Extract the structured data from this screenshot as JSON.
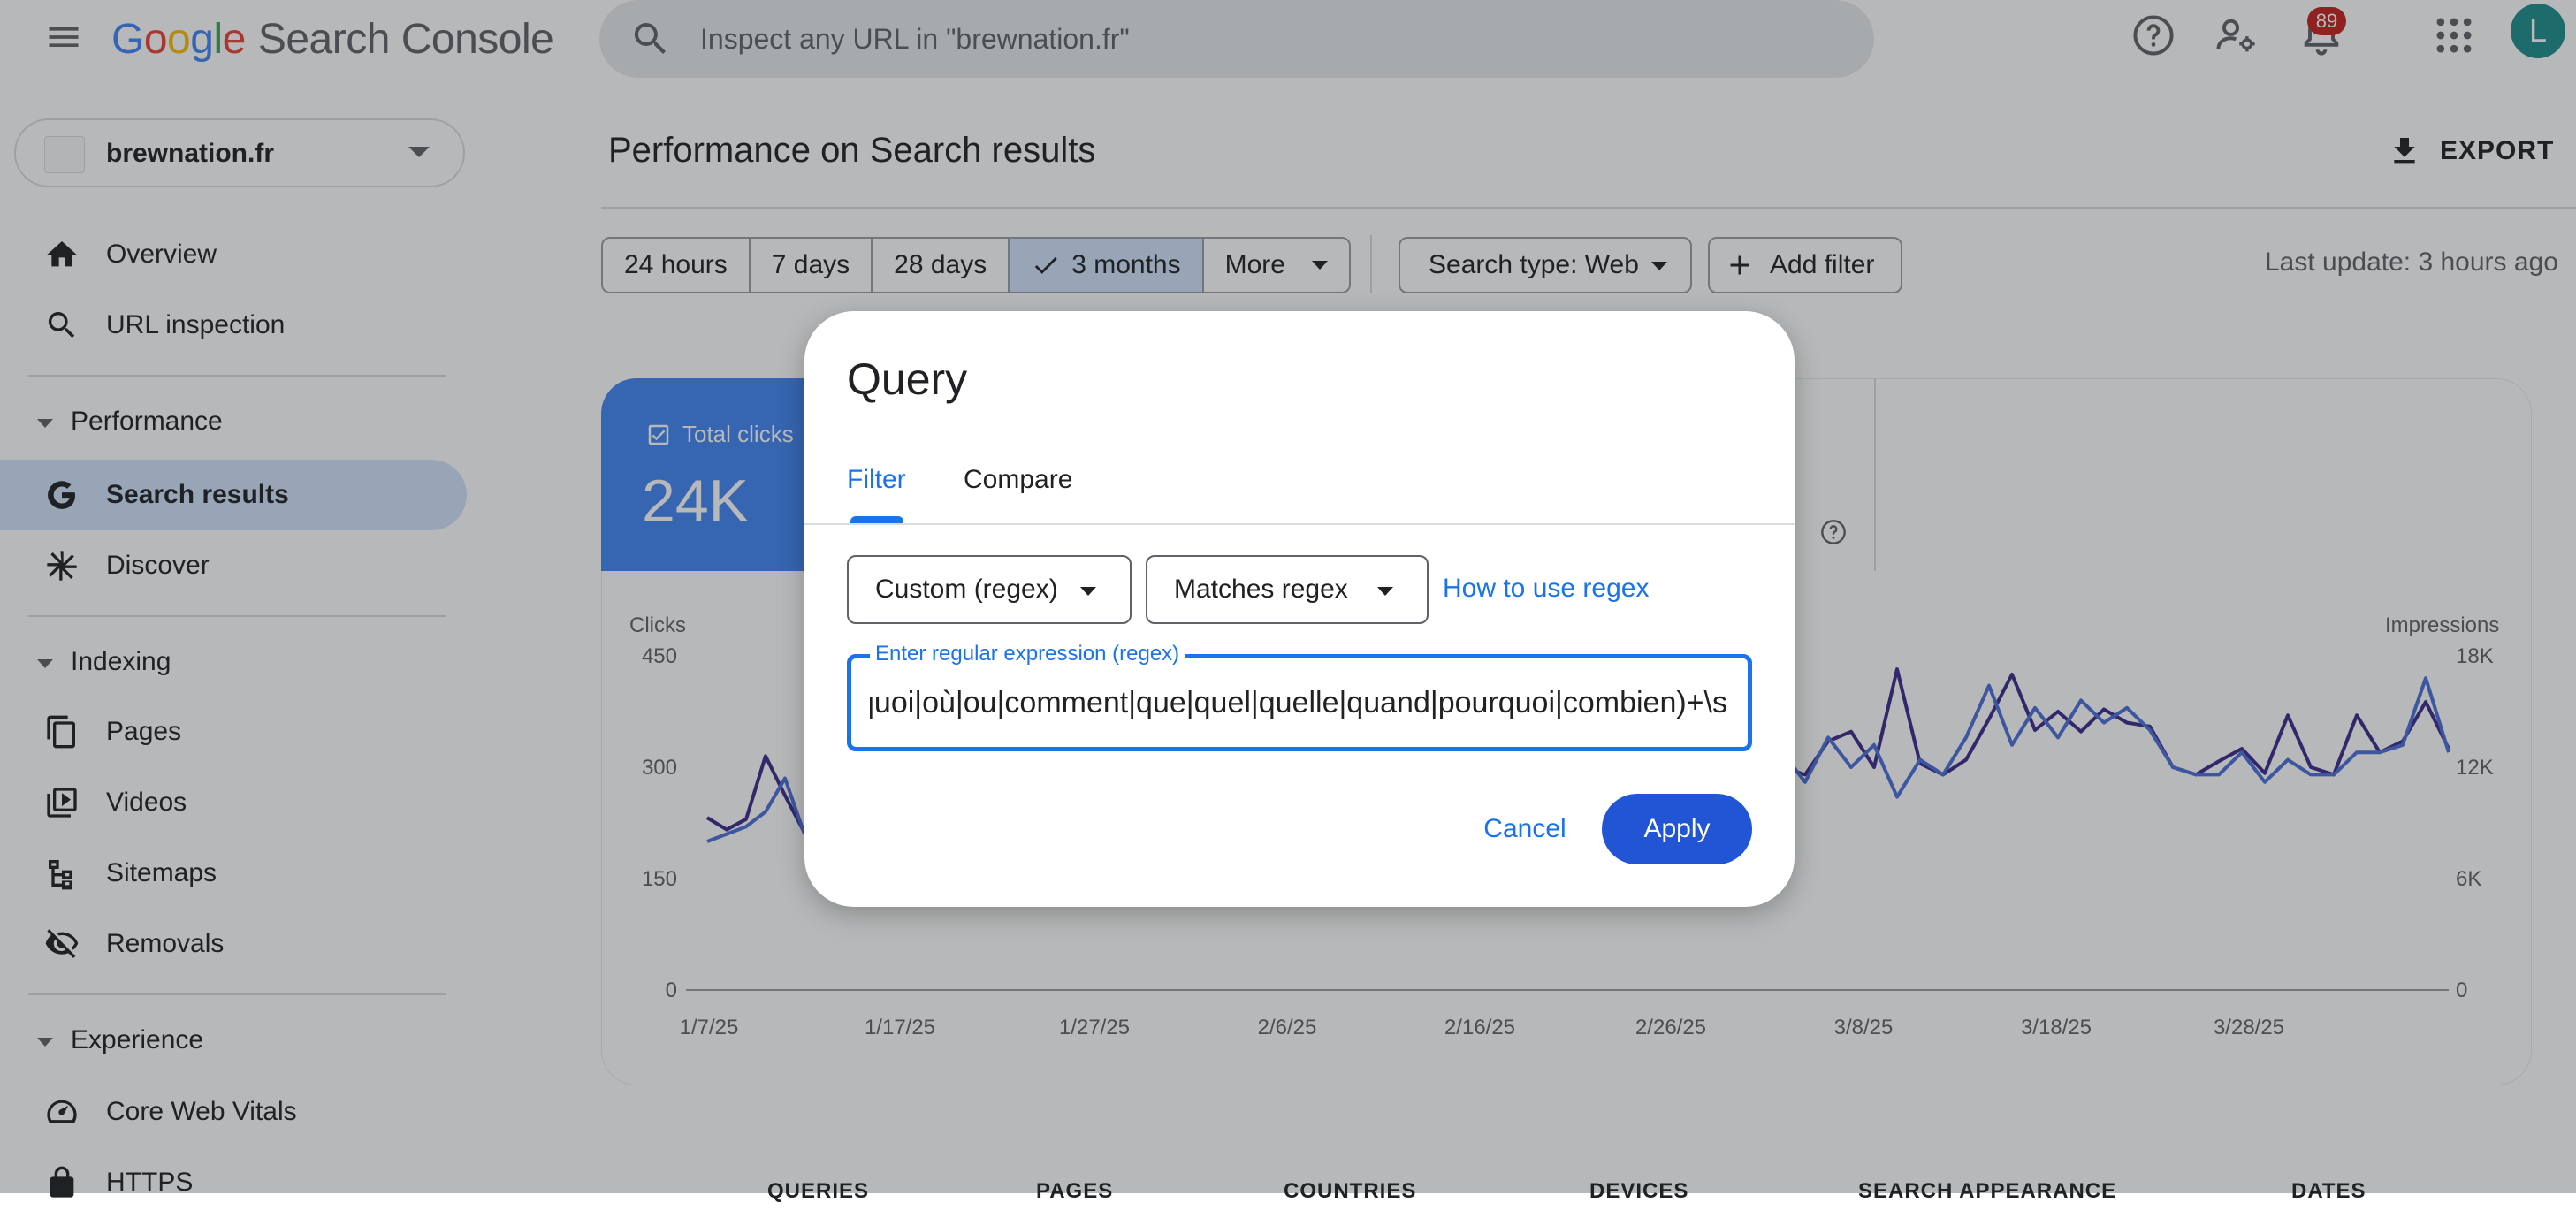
{
  "app": {
    "logo_letters": [
      "G",
      "o",
      "o",
      "g",
      "l",
      "e"
    ],
    "product": "Search Console",
    "search_placeholder": "Inspect any URL in \"brewnation.fr\"",
    "notifications_count": "89",
    "avatar_initial": "L"
  },
  "sidebar": {
    "property": "brewnation.fr",
    "items": {
      "overview": "Overview",
      "url_inspection": "URL inspection",
      "performance_section": "Performance",
      "search_results": "Search results",
      "discover": "Discover",
      "indexing_section": "Indexing",
      "pages": "Pages",
      "videos": "Videos",
      "sitemaps": "Sitemaps",
      "removals": "Removals",
      "experience_section": "Experience",
      "core_web_vitals": "Core Web Vitals",
      "https": "HTTPS"
    }
  },
  "main": {
    "title": "Performance on Search results",
    "export_label": "EXPORT",
    "ranges": [
      "24 hours",
      "7 days",
      "28 days",
      "3 months",
      "More"
    ],
    "selected_range": "3 months",
    "search_type": "Search type: Web",
    "add_filter": "Add filter",
    "last_update": "Last update: 3 hours ago",
    "metric_label": "Total clicks",
    "metric_value": "24K",
    "bottom_tabs": [
      "QUERIES",
      "PAGES",
      "COUNTRIES",
      "DEVICES",
      "SEARCH APPEARANCE",
      "DATES"
    ]
  },
  "chart_data": {
    "type": "line",
    "ylabel": "Clicks",
    "y2label": "Impressions",
    "y_ticks": [
      "450",
      "300",
      "150",
      "0"
    ],
    "y2_ticks": [
      "18K",
      "12K",
      "6K",
      "0"
    ],
    "ylim": [
      0,
      450
    ],
    "y2lim": [
      0,
      18000
    ],
    "x_ticks": [
      "1/7/25",
      "1/17/25",
      "1/27/25",
      "2/6/25",
      "2/16/25",
      "2/26/25",
      "3/8/25",
      "3/18/25",
      "3/28/25"
    ],
    "colors": {
      "clicks": "#3c2a8c",
      "impressions": "#4a6fd9"
    },
    "series": [
      {
        "name": "Clicks",
        "visible_left": [
          232,
          216,
          230,
          315,
          262,
          212
        ],
        "visible_right": [
          295,
          300,
          290,
          335,
          348,
          300,
          432,
          305,
          290,
          310,
          365,
          425,
          350,
          375,
          348,
          378,
          360,
          355,
          300,
          290,
          308,
          325,
          292,
          370,
          300,
          290,
          370,
          320,
          335,
          388,
          325
        ]
      },
      {
        "name": "Impressions",
        "visible_left": [
          8000,
          8400,
          8800,
          9600,
          11400,
          8400
        ],
        "visible_right": [
          11600,
          12800,
          11200,
          13600,
          12000,
          13200,
          10400,
          12400,
          11600,
          13600,
          16400,
          13200,
          15200,
          13600,
          15600,
          14400,
          15200,
          14000,
          12000,
          11600,
          11600,
          12800,
          11200,
          12400,
          11600,
          11600,
          12800,
          12800,
          13200,
          16800,
          12800
        ]
      }
    ]
  },
  "dialog": {
    "title": "Query",
    "tabs": {
      "filter": "Filter",
      "compare": "Compare"
    },
    "type_select": "Custom (regex)",
    "match_select": "Matches regex",
    "help_link": "How to use regex",
    "input_label": "Enter regular expression (regex)",
    "input_value": "^(qui|quoi|où|ou|comment|que|quel|quelle|quand|pourquoi|combien)+\\s",
    "cancel": "Cancel",
    "apply": "Apply"
  }
}
